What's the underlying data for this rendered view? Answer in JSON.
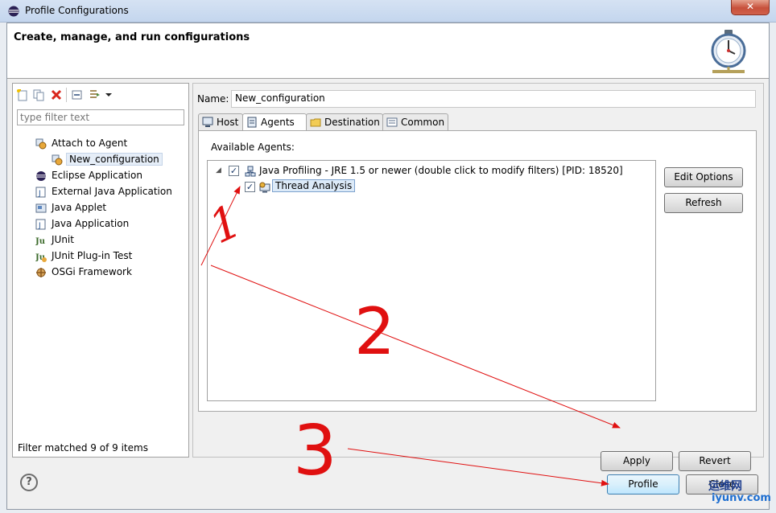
{
  "window": {
    "title": "Profile Configurations",
    "close_label": "✕"
  },
  "header": {
    "title": "Create, manage, and run configurations",
    "image_icon": "stopwatch-icon"
  },
  "left": {
    "toolbar_icons": [
      "new-config-icon",
      "duplicate-icon",
      "delete-icon",
      "collapse-all-icon",
      "filter-icon",
      "dropdown-arrow-icon"
    ],
    "filter_placeholder": "type filter text",
    "tree": [
      {
        "label": "Attach to Agent",
        "icon": "attach-agent-icon",
        "level": 0
      },
      {
        "label": "New_configuration",
        "icon": "attach-agent-icon",
        "level": 1,
        "selected": true
      },
      {
        "label": "Eclipse Application",
        "icon": "eclipse-icon",
        "level": 0
      },
      {
        "label": "External Java Application",
        "icon": "external-java-icon",
        "level": 0
      },
      {
        "label": "Java Applet",
        "icon": "java-applet-icon",
        "level": 0
      },
      {
        "label": "Java Application",
        "icon": "java-application-icon",
        "level": 0
      },
      {
        "label": "JUnit",
        "icon": "junit-icon",
        "level": 0
      },
      {
        "label": "JUnit Plug-in Test",
        "icon": "junit-plugin-icon",
        "level": 0
      },
      {
        "label": "OSGi Framework",
        "icon": "osgi-icon",
        "level": 0
      }
    ],
    "status": "Filter matched 9 of 9 items"
  },
  "main": {
    "name_label": "Name:",
    "name_value": "New_configuration",
    "tabs": [
      {
        "label": "Host",
        "icon": "host-icon"
      },
      {
        "label": "Agents",
        "icon": "agents-icon",
        "active": true
      },
      {
        "label": "Destination",
        "icon": "folder-icon"
      },
      {
        "label": "Common",
        "icon": "common-icon"
      }
    ],
    "available_label": "Available Agents:",
    "agents": [
      {
        "label": "Java Profiling - JRE 1.5 or newer (double click to modify filters) [PID: 18520]",
        "checked": true,
        "expanded": true
      },
      {
        "label": "Thread Analysis",
        "checked": true,
        "selected": true
      }
    ],
    "edit_options": "Edit Options",
    "refresh": "Refresh",
    "apply": "Apply",
    "revert": "Revert"
  },
  "footer": {
    "help": "?",
    "profile": "Profile",
    "close": "Close"
  },
  "annotations": {
    "marks": [
      "1",
      "2",
      "3"
    ],
    "color": "#e01010"
  },
  "watermark": {
    "line1": "运维网",
    "line2": "iyunv.com"
  }
}
